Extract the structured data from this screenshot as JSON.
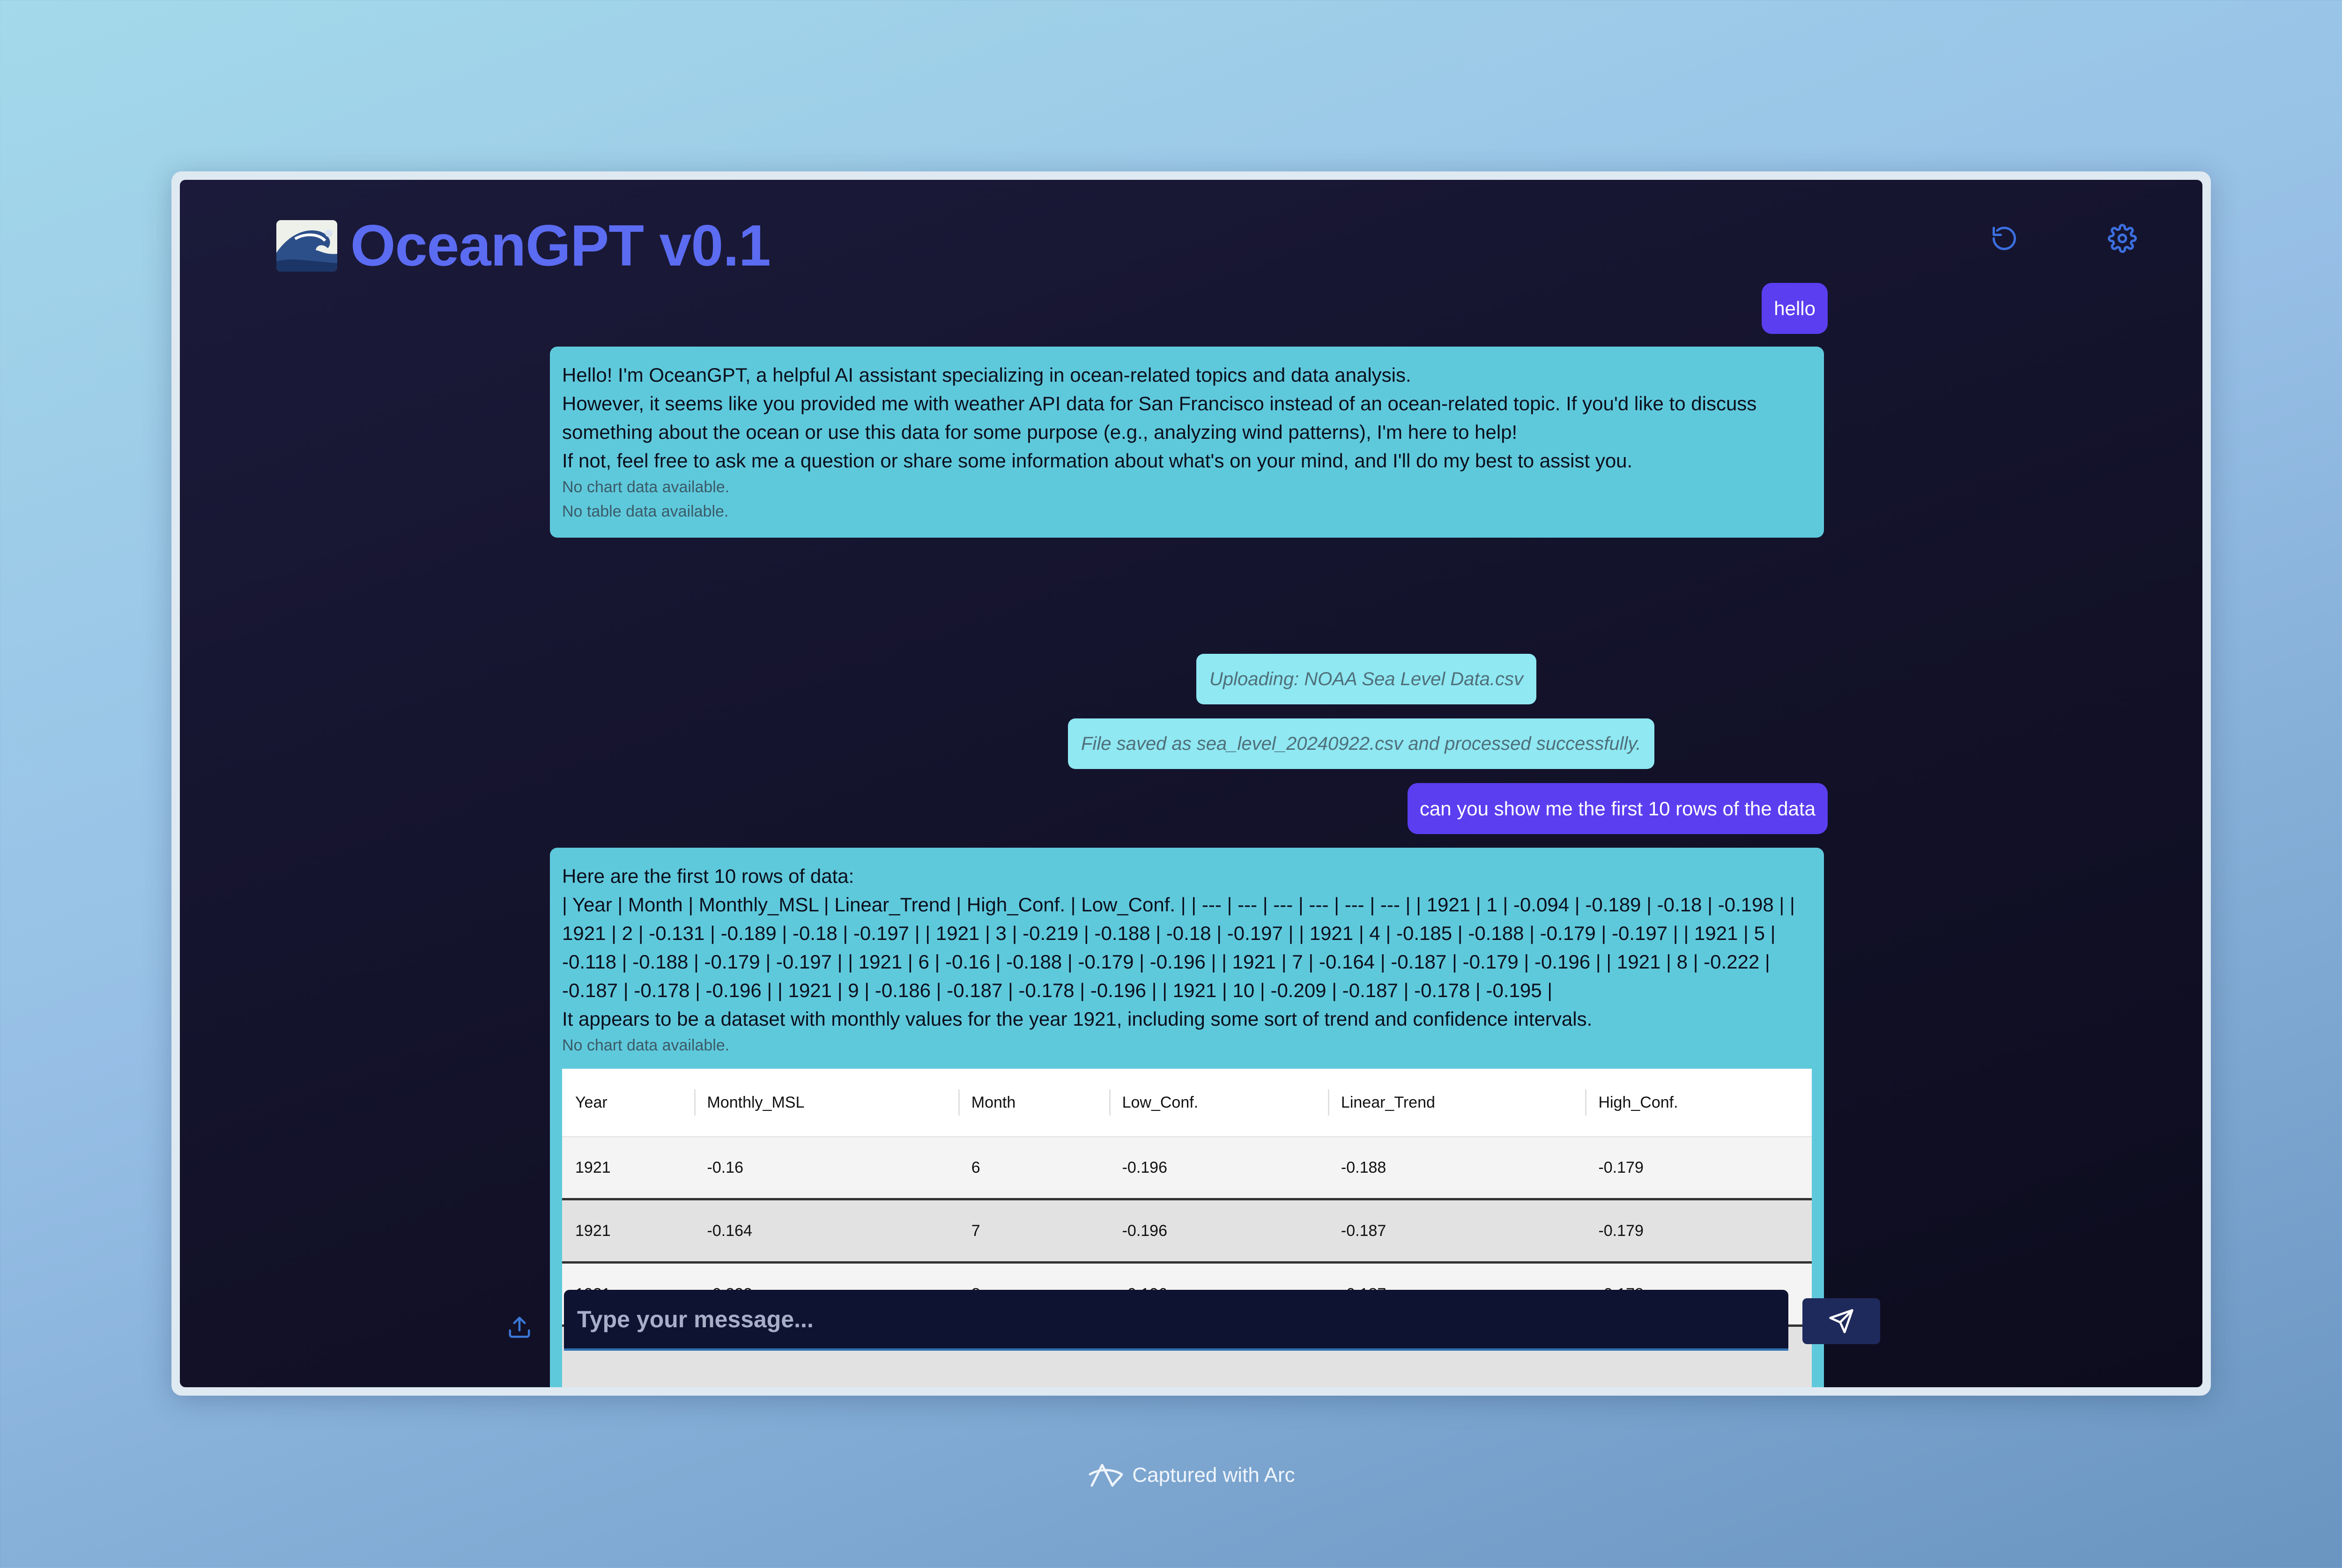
{
  "app": {
    "title": "OceanGPT v0.1",
    "logo_icon": "great-wave-emoji",
    "accent_color": "#5b6cf2"
  },
  "header": {
    "reset_icon": "rotate-ccw-icon",
    "settings_icon": "gear-icon"
  },
  "messages": {
    "user_1": "hello",
    "bot_1": {
      "lines": [
        "Hello! I'm OceanGPT, a helpful AI assistant specializing in ocean-related topics and data analysis.",
        "However, it seems like you provided me with weather API data for San Francisco instead of an ocean-related topic. If you'd like to discuss something about the ocean or use this data for some purpose (e.g., analyzing wind patterns), I'm here to help!",
        "If not, feel free to ask me a question or share some information about what's on your mind, and I'll do my best to assist you."
      ],
      "chart_note": "No chart data available.",
      "table_note": "No table data available."
    },
    "status_upload": "Uploading: NOAA Sea Level Data.csv",
    "status_saved": "File saved as sea_level_20240922.csv and processed successfully.",
    "user_2": "can you show me the first 10 rows of the data",
    "bot_2": {
      "intro": "Here are the first 10 rows of data:",
      "markdown": "| Year | Month | Monthly_MSL | Linear_Trend | High_Conf. | Low_Conf. | | --- | --- | --- | --- | --- | --- | | 1921 | 1 | -0.094 | -0.189 | -0.18 | -0.198 | | 1921 | 2 | -0.131 | -0.189 | -0.18 | -0.197 | | 1921 | 3 | -0.219 | -0.188 | -0.18 | -0.197 | | 1921 | 4 | -0.185 | -0.188 | -0.179 | -0.197 | | 1921 | 5 | -0.118 | -0.188 | -0.179 | -0.197 | | 1921 | 6 | -0.16 | -0.188 | -0.179 | -0.196 | | 1921 | 7 | -0.164 | -0.187 | -0.179 | -0.196 | | 1921 | 8 | -0.222 | -0.187 | -0.178 | -0.196 | | 1921 | 9 | -0.186 | -0.187 | -0.178 | -0.196 | | 1921 | 10 | -0.209 | -0.187 | -0.178 | -0.195 |",
      "summary": "It appears to be a dataset with monthly values for the year 1921, including some sort of trend and confidence intervals.",
      "chart_note": "No chart data available.",
      "table": {
        "headers": [
          "Year",
          "Monthly_MSL",
          "Month",
          "Low_Conf.",
          "Linear_Trend",
          "High_Conf."
        ],
        "rows": [
          [
            "1921",
            "-0.16",
            "6",
            "-0.196",
            "-0.188",
            "-0.179"
          ],
          [
            "1921",
            "-0.164",
            "7",
            "-0.196",
            "-0.187",
            "-0.179"
          ],
          [
            "1921",
            "-0.222",
            "8",
            "-0.196",
            "-0.187",
            "-0.178"
          ]
        ]
      }
    }
  },
  "composer": {
    "placeholder": "Type your message...",
    "upload_icon": "upload-icon",
    "send_icon": "send-icon"
  },
  "footer": {
    "caption": "Captured with Arc",
    "arc_icon": "arc-logo-icon"
  }
}
